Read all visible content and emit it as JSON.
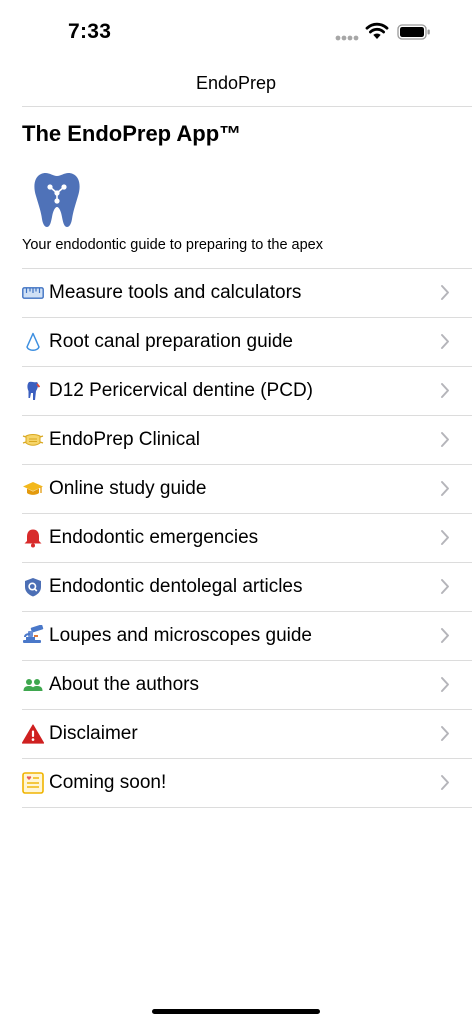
{
  "status_bar": {
    "time": "7:33"
  },
  "nav": {
    "title": "EndoPrep"
  },
  "header": {
    "app_title": "The EndoPrep App™",
    "tagline": "Your endodontic guide to preparing to the apex"
  },
  "colors": {
    "logo_blue": "#4F72B8",
    "divider": "#DCDCDC",
    "chevron": "#B5B5BA"
  },
  "menu": {
    "items": [
      {
        "label": "Measure tools and calculators",
        "icon": "ruler-icon"
      },
      {
        "label": "Root canal preparation guide",
        "icon": "drop-icon"
      },
      {
        "label": "D12 Pericervical dentine (PCD)",
        "icon": "tooth-drill-icon"
      },
      {
        "label": "EndoPrep Clinical",
        "icon": "face-mask-icon"
      },
      {
        "label": "Online study guide",
        "icon": "graduation-cap-icon"
      },
      {
        "label": "Endodontic emergencies",
        "icon": "bell-icon"
      },
      {
        "label": "Endodontic dentolegal articles",
        "icon": "shield-search-icon"
      },
      {
        "label": "Loupes and microscopes guide",
        "icon": "microscope-icon"
      },
      {
        "label": "About the authors",
        "icon": "people-icon"
      },
      {
        "label": "Disclaimer",
        "icon": "warning-icon"
      },
      {
        "label": "Coming soon!",
        "icon": "notice-board-icon"
      }
    ]
  }
}
